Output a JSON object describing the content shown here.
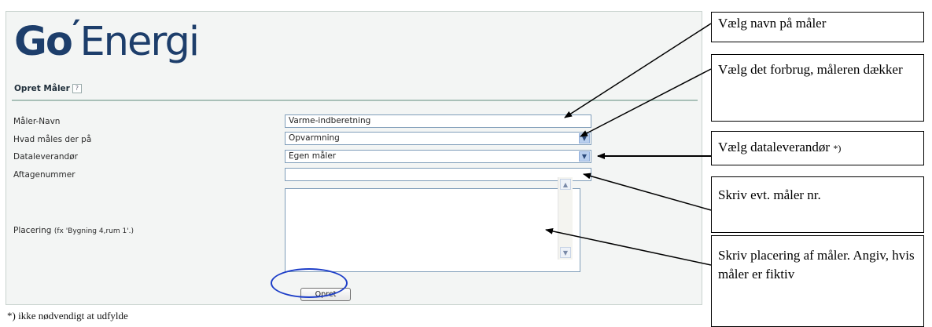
{
  "logo": {
    "go": "Go",
    "energi": "Energi"
  },
  "form": {
    "title": "Opret Måler",
    "help_icon": "?",
    "fields": {
      "navn": {
        "label": "Måler-Navn",
        "value": "Varme-indberetning"
      },
      "maales": {
        "label": "Hvad måles der på",
        "value": "Opvarmning"
      },
      "dataleverandor": {
        "label": "Dataleverandør",
        "value": "Egen måler"
      },
      "aftagenummer": {
        "label": "Aftagenummer",
        "value": ""
      },
      "placering": {
        "label": "Placering",
        "hint": "(fx 'Bygning 4,rum 1'.)",
        "value": ""
      }
    },
    "submit_label": "Opret"
  },
  "footnote": "*) ikke nødvendigt at udfylde",
  "callouts": {
    "navn": "Vælg navn på måler",
    "forbrug": "Vælg det forbrug, måleren dækker",
    "dataleverandor": "Vælg dataleverandør",
    "dataleverandor_mark": "*)",
    "maalernr": "Skriv evt. måler nr.",
    "placering": "Skriv placering af måler. Angiv, hvis måler er fiktiv"
  },
  "colors": {
    "logo": "#1d3e6b",
    "ring": "#1d3ec8",
    "panel": "#f3f5f4"
  }
}
